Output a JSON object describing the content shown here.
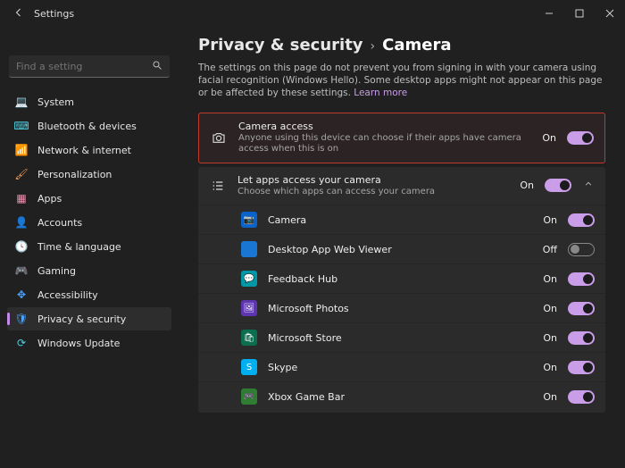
{
  "window": {
    "title": "Settings"
  },
  "search": {
    "placeholder": "Find a setting"
  },
  "sidebar": {
    "items": [
      {
        "label": "System",
        "icon": "💻",
        "tint": "c-blue"
      },
      {
        "label": "Bluetooth & devices",
        "icon": "⌨",
        "tint": "c-teal"
      },
      {
        "label": "Network & internet",
        "icon": "📶",
        "tint": "c-teal"
      },
      {
        "label": "Personalization",
        "icon": "🖌",
        "tint": "c-orange"
      },
      {
        "label": "Apps",
        "icon": "▦",
        "tint": "c-pink"
      },
      {
        "label": "Accounts",
        "icon": "👤",
        "tint": "c-green"
      },
      {
        "label": "Time & language",
        "icon": "🕓",
        "tint": "c-yellow"
      },
      {
        "label": "Gaming",
        "icon": "🎮",
        "tint": "c-green"
      },
      {
        "label": "Accessibility",
        "icon": "✥",
        "tint": "c-blue"
      },
      {
        "label": "Privacy & security",
        "icon": "🛡",
        "tint": "c-blue",
        "active": true
      },
      {
        "label": "Windows Update",
        "icon": "⟳",
        "tint": "c-teal"
      }
    ]
  },
  "breadcrumb": {
    "parent": "Privacy & security",
    "sep": "›",
    "current": "Camera"
  },
  "description": {
    "text": "The settings on this page do not prevent you from signing in with your camera using facial recognition (Windows Hello). Some desktop apps might not appear on this page or be affected by these settings. ",
    "link": "Learn more"
  },
  "camera_access": {
    "title": "Camera access",
    "subtitle": "Anyone using this device can choose if their apps have camera access when this is on",
    "state": "On",
    "on": true
  },
  "apps_access": {
    "title": "Let apps access your camera",
    "subtitle": "Choose which apps can access your camera",
    "state": "On",
    "on": true,
    "expanded": true
  },
  "apps": [
    {
      "name": "Camera",
      "state": "On",
      "on": true,
      "bg": "bg-blue",
      "glyph": "📷"
    },
    {
      "name": "Desktop App Web Viewer",
      "state": "Off",
      "on": false,
      "bg": "bg-blue2",
      "glyph": ""
    },
    {
      "name": "Feedback Hub",
      "state": "On",
      "on": true,
      "bg": "bg-teal",
      "glyph": "💬"
    },
    {
      "name": "Microsoft Photos",
      "state": "On",
      "on": true,
      "bg": "bg-purple",
      "glyph": "🖼"
    },
    {
      "name": "Microsoft Store",
      "state": "On",
      "on": true,
      "bg": "bg-store",
      "glyph": "🛍"
    },
    {
      "name": "Skype",
      "state": "On",
      "on": true,
      "bg": "bg-skype",
      "glyph": "S"
    },
    {
      "name": "Xbox Game Bar",
      "state": "On",
      "on": true,
      "bg": "bg-green",
      "glyph": "🎮"
    }
  ]
}
